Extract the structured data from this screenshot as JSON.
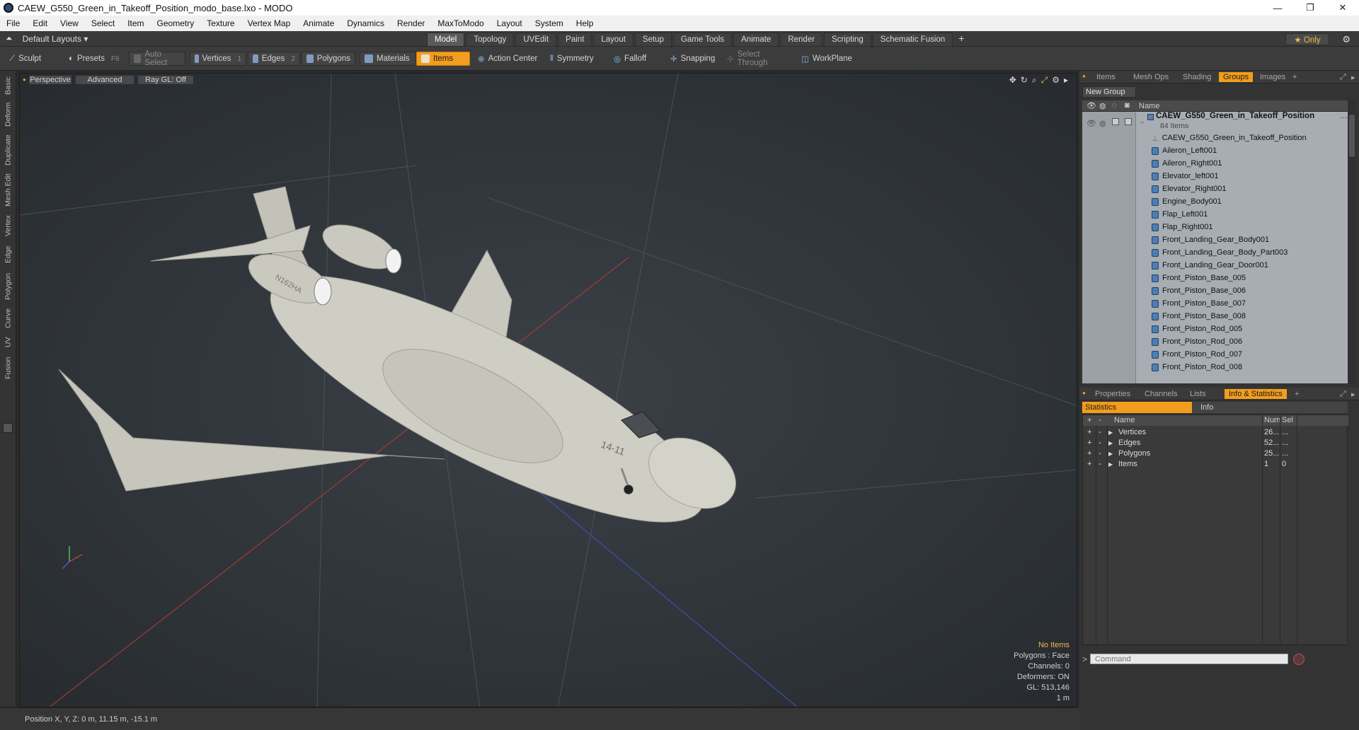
{
  "window": {
    "title": "CAEW_G550_Green_in_Takeoff_Position_modo_base.lxo - MODO",
    "minimize": "—",
    "maximize": "❐",
    "close": "✕"
  },
  "menu": [
    "File",
    "Edit",
    "View",
    "Select",
    "Item",
    "Geometry",
    "Texture",
    "Vertex Map",
    "Animate",
    "Dynamics",
    "Render",
    "MaxToModo",
    "Layout",
    "System",
    "Help"
  ],
  "layoutbar": {
    "layout_label": "Default Layouts ▾",
    "only_label": "★  Only",
    "add": "+",
    "tabs": [
      "Model",
      "Topology",
      "UVEdit",
      "Paint",
      "Layout",
      "Setup",
      "Game Tools",
      "Animate",
      "Render",
      "Scripting",
      "Schematic Fusion"
    ]
  },
  "toolbar": {
    "sculpt": "Sculpt",
    "presets": "Presets",
    "presets_key": "F6",
    "auto_select": "Auto Select",
    "vertices": "Vertices",
    "vertices_n": "1",
    "edges": "Edges",
    "edges_n": "2",
    "polygons": "Polygons",
    "materials": "Materials",
    "items": "Items",
    "action_center": "Action Center",
    "symmetry": "Symmetry",
    "falloff": "Falloff",
    "snapping": "Snapping",
    "select_through": "Select Through",
    "workplane": "WorkPlane"
  },
  "lefttabs": [
    "Basic",
    "Deform",
    "Duplicate",
    "Mesh Edit",
    "Vertex",
    "Edge",
    "Polygon",
    "Curve",
    "UV",
    "Fusion"
  ],
  "viewport": {
    "view_mode": "Perspective",
    "shading": "Advanced",
    "raygl": "Ray GL: Off",
    "info": {
      "items": "No Items",
      "polygons": "Polygons : Face",
      "channels": "Channels: 0",
      "deformers": "Deformers: ON",
      "gl": "GL: 513,146",
      "scale": "1 m"
    },
    "tail_reg": "N162HA",
    "nose_no": "14-11"
  },
  "status": {
    "position": "Position X, Y, Z:  0 m, 11.15 m, -15.1 m"
  },
  "panel_tabs_top": [
    "Items",
    "Mesh Ops",
    "Shading",
    "Groups",
    "Images"
  ],
  "new_group": "New Group",
  "groups_header": {
    "name": "Name"
  },
  "groups": {
    "root": "CAEW_G550_Green_in_Takeoff_Position",
    "root_count": "84 Items",
    "items": [
      "CAEW_G550_Green_in_Takeoff_Position",
      "Aileron_Left001",
      "Aileron_Right001",
      "Elevator_left001",
      "Elevator_Right001",
      "Engine_Body001",
      "Flap_Left001",
      "Flap_Right001",
      "Front_Landing_Gear_Body001",
      "Front_Landing_Gear_Body_Part003",
      "Front_Landing_Gear_Door001",
      "Front_Piston_Base_005",
      "Front_Piston_Base_006",
      "Front_Piston_Base_007",
      "Front_Piston_Base_008",
      "Front_Piston_Rod_005",
      "Front_Piston_Rod_006",
      "Front_Piston_Rod_007",
      "Front_Piston_Rod_008"
    ]
  },
  "panel_tabs_bottom": [
    "Properties",
    "Channels",
    "Lists",
    "Info & Statistics"
  ],
  "stats": {
    "tab_statistics": "Statistics",
    "tab_info": "Info",
    "cols": {
      "name": "Name",
      "num": "Num",
      "sel": "Sel"
    },
    "rows": [
      {
        "name": "Vertices",
        "num": "26...",
        "sel": "..."
      },
      {
        "name": "Edges",
        "num": "52...",
        "sel": "..."
      },
      {
        "name": "Polygons",
        "num": "25...",
        "sel": "..."
      },
      {
        "name": "Items",
        "num": "1",
        "sel": "0"
      }
    ]
  },
  "command": {
    "placeholder": "Command",
    "prompt": ">"
  }
}
